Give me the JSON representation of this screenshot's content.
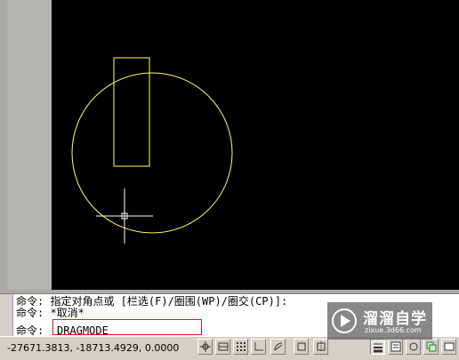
{
  "command_window": {
    "lines": [
      "命令: 指定对角点或 [栏选(F)/圈围(WP)/圈交(CP)]:",
      "命令: *取消*"
    ],
    "prompt_label": "命令:",
    "input_value": "DRAGMODE"
  },
  "status_bar": {
    "coordinates": "-27671.3813, -18713.4929, 0.0000",
    "toggles": [
      {
        "icon": "snap-icon",
        "on": false
      },
      {
        "icon": "grid-icon",
        "on": false
      },
      {
        "icon": "ortho-icon",
        "on": false
      },
      {
        "icon": "polar-icon",
        "on": false
      },
      {
        "icon": "osnap-icon",
        "on": false
      },
      {
        "icon": "otrack-icon",
        "on": false
      },
      {
        "icon": "ucs-icon",
        "on": true
      },
      {
        "icon": "dyn-icon",
        "on": false
      },
      {
        "icon": "lineweight-icon",
        "on": false
      },
      {
        "icon": "qp-icon",
        "on": false
      },
      {
        "icon": "sc-icon",
        "on": false
      }
    ]
  },
  "drawing": {
    "entity_color": "#ffff66",
    "crosshair_color": "#ffffff",
    "background_color": "#000000"
  },
  "watermark": {
    "title": "溜溜自学",
    "subtitle": "zixue.3d66.com"
  }
}
